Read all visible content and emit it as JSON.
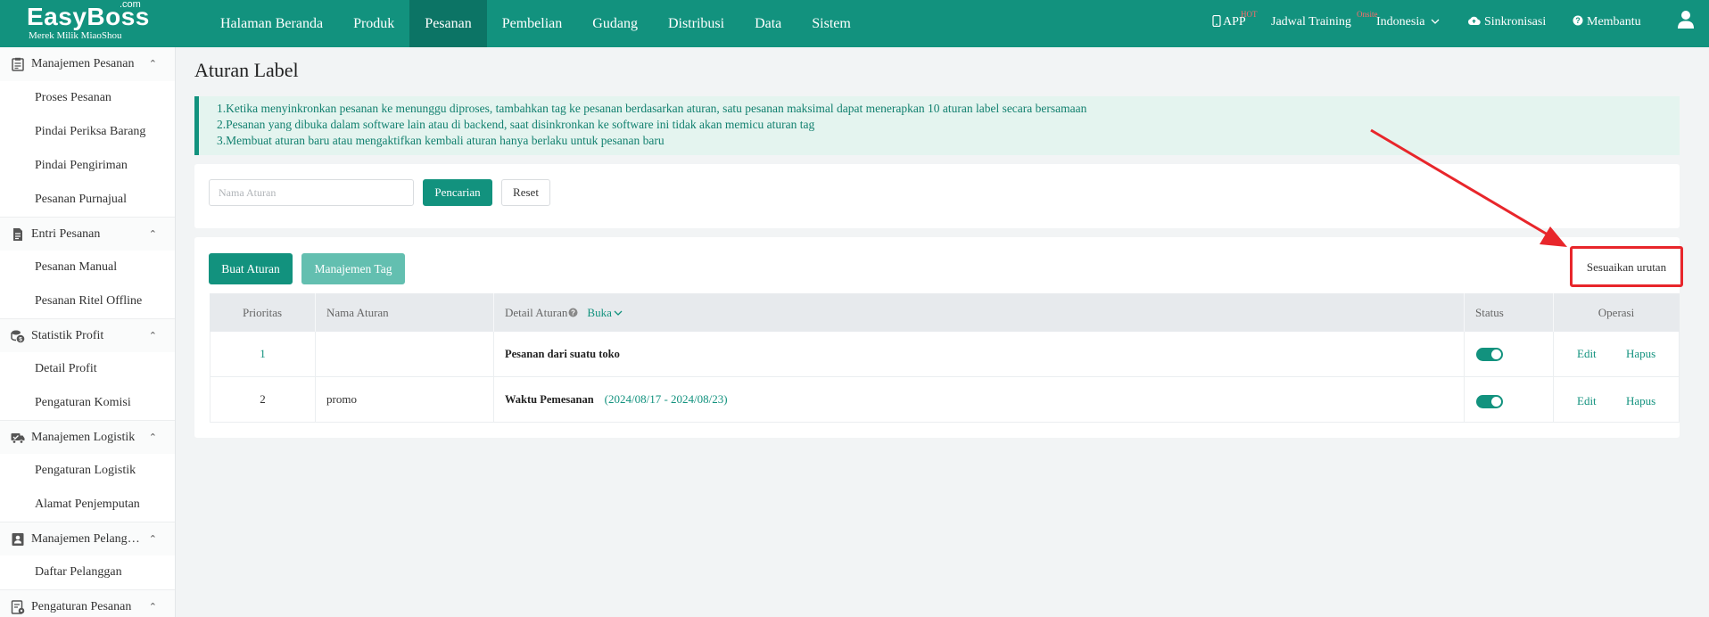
{
  "brand": {
    "name": "EasyBoss",
    "com": ".com",
    "tagline": "Merek Milik MiaoShou"
  },
  "nav": {
    "items": [
      {
        "label": "Halaman Beranda"
      },
      {
        "label": "Produk"
      },
      {
        "label": "Pesanan",
        "active": true
      },
      {
        "label": "Pembelian"
      },
      {
        "label": "Gudang"
      },
      {
        "label": "Distribusi"
      },
      {
        "label": "Data"
      },
      {
        "label": "Sistem"
      }
    ]
  },
  "top_right": {
    "app_label": "APP",
    "app_badge": "HOT",
    "training_label": "Jadwal Training",
    "training_badge": "Onsite",
    "language": "Indonesia",
    "sync_label": "Sinkronisasi",
    "help_label": "Membantu"
  },
  "sidebar": {
    "groups": [
      {
        "label": "Manajemen Pesanan",
        "icon": "clipboard-icon",
        "items": [
          "Proses Pesanan",
          "Pindai Periksa Barang",
          "Pindai Pengiriman",
          "Pesanan Purnajual"
        ]
      },
      {
        "label": "Entri Pesanan",
        "icon": "document-icon",
        "items": [
          "Pesanan Manual",
          "Pesanan Ritel Offline"
        ]
      },
      {
        "label": "Statistik Profit",
        "icon": "coins-icon",
        "items": [
          "Detail Profit",
          "Pengaturan Komisi"
        ]
      },
      {
        "label": "Manajemen Logistik",
        "icon": "truck-icon",
        "items": [
          "Pengaturan Logistik",
          "Alamat Penjemputan"
        ]
      },
      {
        "label": "Manajemen Pelanggan",
        "icon": "contacts-icon",
        "items": [
          "Daftar Pelanggan"
        ]
      },
      {
        "label": "Pengaturan Pesanan",
        "icon": "settings-doc-icon",
        "items": []
      }
    ]
  },
  "page": {
    "title": "Aturan Label",
    "notice": [
      "1.Ketika menyinkronkan pesanan ke menunggu diproses, tambahkan tag ke pesanan berdasarkan aturan, satu pesanan maksimal dapat menerapkan 10 aturan label secara bersamaan",
      "2.Pesanan yang dibuka dalam software lain atau di backend, saat disinkronkan ke software ini tidak akan memicu aturan tag",
      "3.Membuat aturan baru atau mengaktifkan kembali aturan hanya berlaku untuk pesanan baru"
    ],
    "search": {
      "placeholder": "Nama Aturan",
      "search_label": "Pencarian",
      "reset_label": "Reset"
    },
    "actions": {
      "create_label": "Buat Aturan",
      "tag_mgmt_label": "Manajemen Tag",
      "adjust_order_label": "Sesuaikan urutan"
    },
    "table": {
      "headers": {
        "priority": "Prioritas",
        "name": "Nama Aturan",
        "detail": "Detail Aturan",
        "expand": "Buka",
        "status": "Status",
        "operation": "Operasi"
      },
      "rows": [
        {
          "priority": "1",
          "name": "",
          "detail_label": "Pesanan dari suatu toko",
          "detail_value": "",
          "status_on": true,
          "edit": "Edit",
          "delete": "Hapus"
        },
        {
          "priority": "2",
          "name": "promo",
          "detail_label": "Waktu Pemesanan",
          "detail_value": "(2024/08/17 - 2024/08/23)",
          "status_on": true,
          "edit": "Edit",
          "delete": "Hapus"
        }
      ]
    }
  },
  "colors": {
    "primary": "#12927e",
    "primary_dark": "#0c7465",
    "annotation": "#e8262b",
    "notice_bg": "#e4f4ef"
  }
}
